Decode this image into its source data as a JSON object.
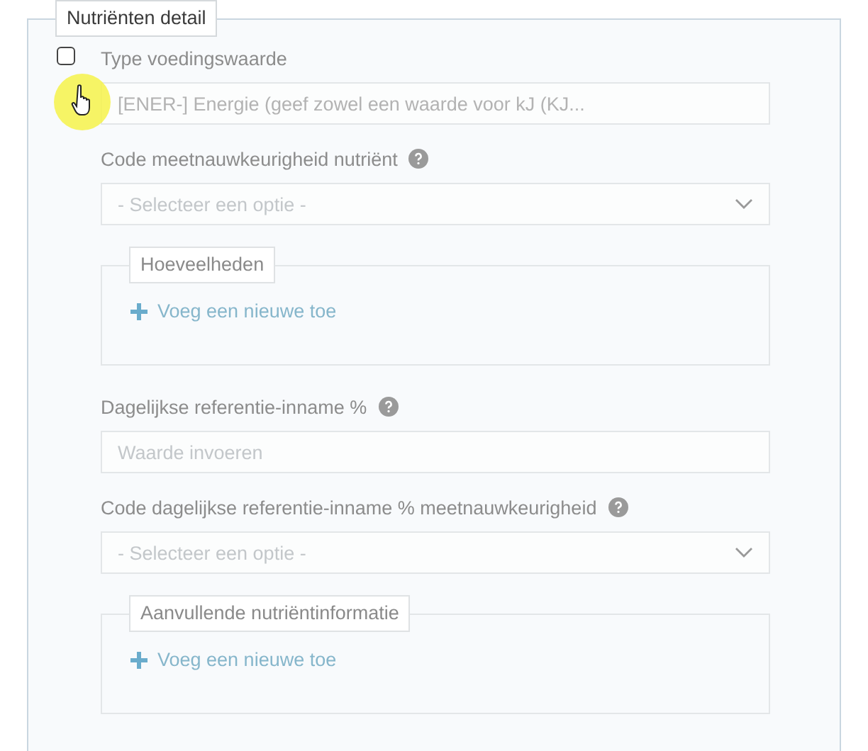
{
  "panel": {
    "legend": "Nutriënten detail",
    "checkbox": {
      "checked": false
    },
    "fields": [
      {
        "kind": "text",
        "label": "Type voedingswaarde",
        "value": "[ENER-] Energie (geef zowel een waarde voor kJ (KJ...",
        "help": false
      },
      {
        "kind": "select",
        "label": "Code meetnauwkeurigheid nutriënt",
        "placeholder": "- Selecteer een optie -",
        "help": true
      },
      {
        "kind": "group",
        "legend": "Hoeveelheden",
        "link": "Voeg een nieuwe toe"
      },
      {
        "kind": "text",
        "label": "Dagelijkse referentie-inname %",
        "placeholder": "Waarde invoeren",
        "help": true
      },
      {
        "kind": "select",
        "label": "Code dagelijkse referentie-inname % meetnauwkeurigheid",
        "placeholder": "- Selecteer een optie -",
        "help": true
      },
      {
        "kind": "group",
        "legend": "Aanvullende nutriëntinformatie",
        "link": "Voeg een nieuwe toe"
      }
    ]
  }
}
